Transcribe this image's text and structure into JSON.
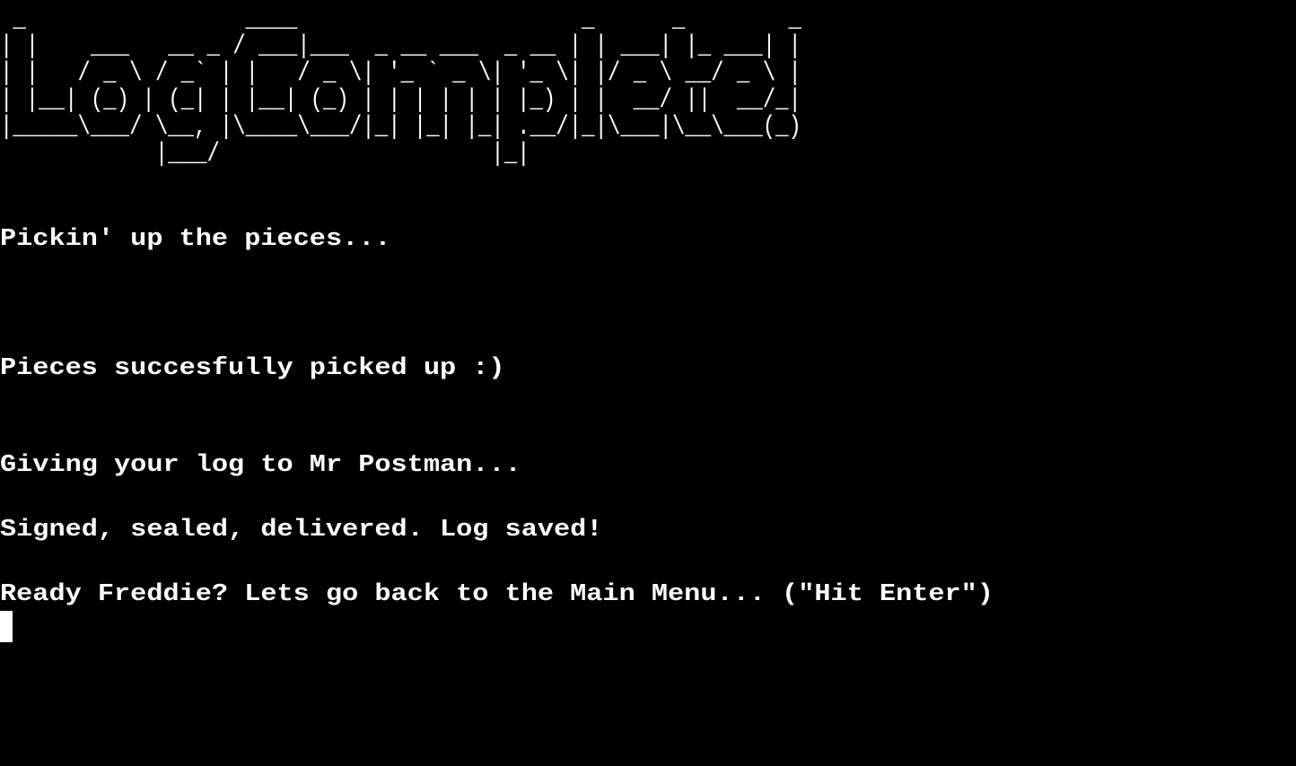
{
  "terminal": {
    "background": "#000000",
    "foreground": "#ffffff",
    "banner": {
      "text": "Log Complete!",
      "ascii_art": " _                 ____                      _      _        _ \n| |    ___   __ _ / ___|___  _ __ ___  _ __ | | ___| |_ ___| |\n| |   / _ \\ / _` | |   / _ \\| '_ ` _ \\| '_ \\| |/ _ \\ __/ _ \\ |\n| |__| (_) | (_| | |__| (_) | | | | | | |_) | |  __/ ||  __/_|\n|_____\\___/ \\__, |\\____\\___/|_| |_| |_| .__/|_|\\___|\\__\\___(_)\n            |___/                     |_|                     "
    },
    "lines": [
      "Pickin' up the pieces...",
      "Pieces succesfully picked up :)",
      "Giving your log to Mr Postman...",
      "Signed, sealed, delivered. Log saved!",
      "Ready Freddie? Lets go back to the Main Menu... (\"Hit Enter\")"
    ]
  }
}
